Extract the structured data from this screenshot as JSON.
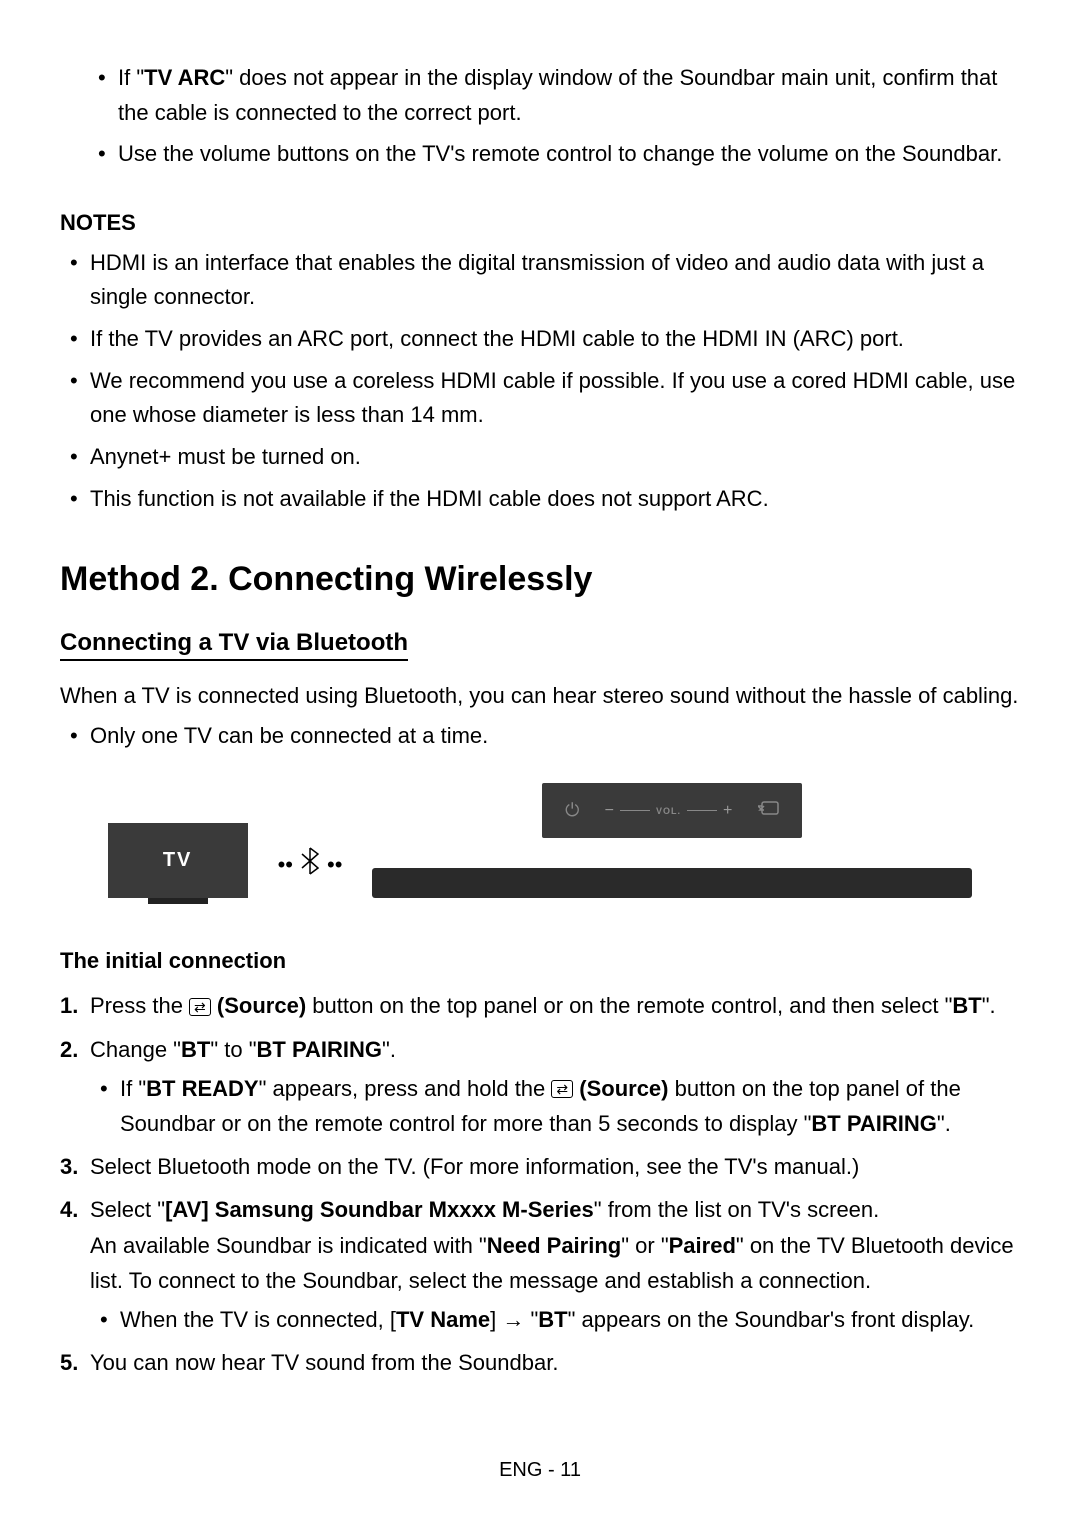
{
  "top_bullets": {
    "item1_pre": "If \"",
    "item1_bold": "TV ARC",
    "item1_post": "\" does not appear in the display window of the Soundbar main unit, confirm that the cable is connected to the correct port.",
    "item2": "Use the volume buttons on the TV's remote control to change the volume on the Soundbar."
  },
  "notes_heading": "NOTES",
  "notes": {
    "n1": "HDMI is an interface that enables the digital transmission of video and audio data with just a single connector.",
    "n2": "If the TV provides an ARC port, connect the HDMI cable to the HDMI IN (ARC) port.",
    "n3": "We recommend you use a coreless HDMI cable if possible. If you use a cored HDMI cable, use one whose diameter is less than 14 mm.",
    "n4": "Anynet+ must be turned on.",
    "n5": "This function is not available if the HDMI cable does not support ARC."
  },
  "method_heading": "Method 2. Connecting Wirelessly",
  "bt_heading": "Connecting a TV via Bluetooth",
  "bt_para": "When a TV is connected using Bluetooth, you can hear stereo sound without the hassle of cabling.",
  "bt_bullet": "Only one TV can be connected at a time.",
  "diagram": {
    "tv_label": "TV",
    "vol_label": "VOL.",
    "minus": "−",
    "plus": "+"
  },
  "initial_heading": "The initial connection",
  "steps": {
    "s1_num": "1.",
    "s1_pre": "Press the ",
    "s1_source": "(Source)",
    "s1_mid": " button on the top panel or on the remote control, and then select \"",
    "s1_bt": "BT",
    "s1_post": "\".",
    "s2_num": "2.",
    "s2_pre": "Change \"",
    "s2_bt": "BT",
    "s2_mid": "\" to \"",
    "s2_btp": "BT PAIRING",
    "s2_post": "\".",
    "s2_sub_pre": "If \"",
    "s2_sub_ready": "BT READY",
    "s2_sub_mid1": "\" appears, press and hold the ",
    "s2_sub_source": "(Source)",
    "s2_sub_mid2": " button on the top panel of the Soundbar or on the remote control for more than 5 seconds to display \"",
    "s2_sub_btp": "BT PAIRING",
    "s2_sub_post": "\".",
    "s3_num": "3.",
    "s3_text": "Select Bluetooth mode on the TV. (For more information, see the TV's manual.)",
    "s4_num": "4.",
    "s4_pre": "Select \"",
    "s4_bold": "[AV] Samsung Soundbar Mxxxx M-Series",
    "s4_post": "\" from the list on TV's screen.",
    "s4_line2_pre": "An available Soundbar is indicated with \"",
    "s4_needp": "Need Pairing",
    "s4_line2_mid": "\" or \"",
    "s4_paired": "Paired",
    "s4_line2_post": "\" on the TV Bluetooth device list. To connect to the Soundbar, select the message and establish a connection.",
    "s4_sub_pre": "When the TV is connected, [",
    "s4_sub_tvname": "TV Name",
    "s4_sub_mid": "] → \"",
    "s4_sub_bt": "BT",
    "s4_sub_post": "\" appears on the Soundbar's front display.",
    "s5_num": "5.",
    "s5_text": "You can now hear TV sound from the Soundbar."
  },
  "footer": "ENG - 11"
}
